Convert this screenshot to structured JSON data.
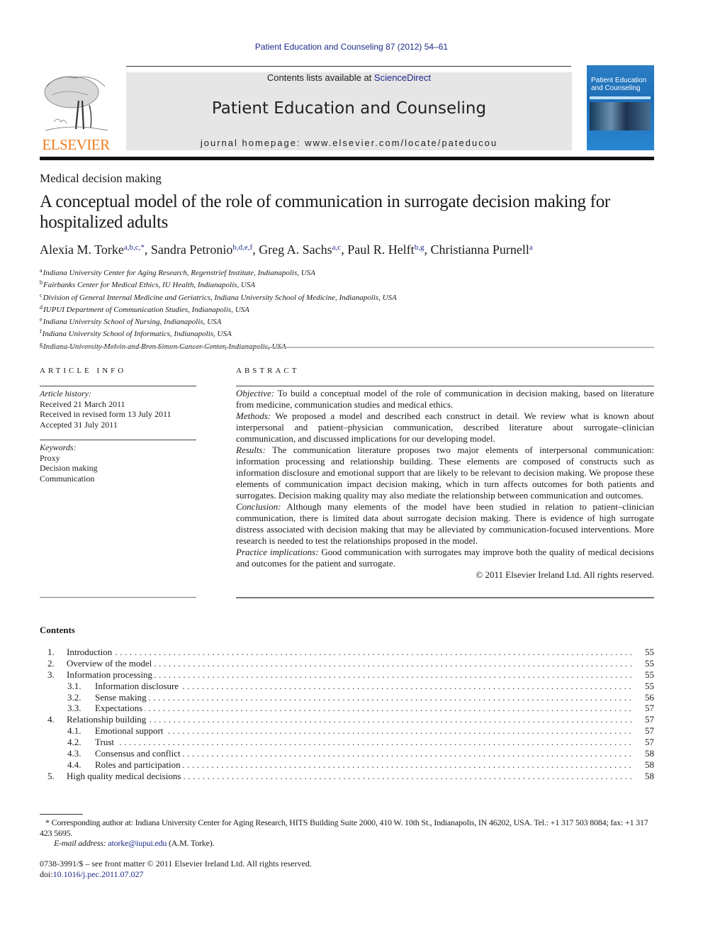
{
  "citation": "Patient Education and Counseling 87 (2012) 54–61",
  "header": {
    "publisher_logo_text": "ELSEVIER",
    "contents_available_prefix": "Contents lists available at ",
    "contents_available_link": "ScienceDirect",
    "journal_title": "Patient Education and Counseling",
    "homepage": "journal homepage: www.elsevier.com/locate/pateducou",
    "cover_title": "Patient Education and Counseling"
  },
  "article": {
    "section": "Medical decision making",
    "title": "A conceptual model of the role of communication in surrogate decision making for hospitalized adults",
    "authors": [
      {
        "name": "Alexia M. Torke",
        "affil": "a,b,c,*"
      },
      {
        "name": "Sandra Petronio",
        "affil": "b,d,e,f"
      },
      {
        "name": "Greg A. Sachs",
        "affil": "a,c"
      },
      {
        "name": "Paul R. Helft",
        "affil": "b,g"
      },
      {
        "name": "Christianna Purnell",
        "affil": "a"
      }
    ],
    "affiliations": [
      {
        "key": "a",
        "text": "Indiana University Center for Aging Research, Regenstrief Institute, Indianapolis, USA"
      },
      {
        "key": "b",
        "text": "Fairbanks Center for Medical Ethics, IU Health, Indianapolis, USA"
      },
      {
        "key": "c",
        "text": "Division of General Internal Medicine and Geriatrics, Indiana University School of Medicine, Indianapolis, USA"
      },
      {
        "key": "d",
        "text": "IUPUI Department of Communication Studies, Indianapolis, USA"
      },
      {
        "key": "e",
        "text": "Indiana University School of Nursing, Indianapolis, USA"
      },
      {
        "key": "f",
        "text": "Indiana University School of Informatics, Indianapolis, USA"
      },
      {
        "key": "g",
        "text": "Indiana University Melvin and Bren Simon Cancer Center, Indianapolis, USA"
      }
    ]
  },
  "article_info": {
    "heading": "ARTICLE INFO",
    "history_label": "Article history:",
    "history": [
      "Received 21 March 2011",
      "Received in revised form 13 July 2011",
      "Accepted 31 July 2011"
    ],
    "keywords_label": "Keywords:",
    "keywords": [
      "Proxy",
      "Decision making",
      "Communication"
    ]
  },
  "abstract": {
    "heading": "ABSTRACT",
    "sections": [
      {
        "label": "Objective:",
        "text": " To build a conceptual model of the role of communication in decision making, based on literature from medicine, communication studies and medical ethics."
      },
      {
        "label": "Methods:",
        "text": "  We proposed a model and described each construct in detail. We review what is known about interpersonal and patient–physician communication, described literature about surrogate–clinician communication, and discussed implications for our developing model."
      },
      {
        "label": "Results:",
        "text": " The communication literature proposes two major elements of interpersonal communication: information processing and relationship building. These elements are composed of constructs such as information disclosure and emotional support that are likely to be relevant to decision making. We propose these elements of communication impact decision making, which in turn affects outcomes for both patients and surrogates. Decision making quality may also mediate the relationship between communication and outcomes."
      },
      {
        "label": "Conclusion:",
        "text": " Although many elements of the model have been studied in relation to patient–clinician communication, there is limited data about surrogate decision making. There is evidence of high surrogate distress associated with decision making that may be alleviated by communication-focused interventions. More research is needed to test the relationships proposed in the model."
      },
      {
        "label": "Practice implications:",
        "text": " Good communication with surrogates may improve both the quality of medical decisions and outcomes for the patient and surrogate."
      }
    ],
    "copyright": "© 2011 Elsevier Ireland Ltd. All rights reserved."
  },
  "contents": {
    "heading": "Contents",
    "items": [
      {
        "num": "1.",
        "title": "Introduction",
        "page": "55",
        "level": 1
      },
      {
        "num": "2.",
        "title": "Overview of the model",
        "page": "55",
        "level": 1
      },
      {
        "num": "3.",
        "title": "Information processing",
        "page": "55",
        "level": 1
      },
      {
        "num": "3.1.",
        "title": "Information disclosure",
        "page": "55",
        "level": 2
      },
      {
        "num": "3.2.",
        "title": "Sense making",
        "page": "56",
        "level": 2
      },
      {
        "num": "3.3.",
        "title": "Expectations",
        "page": "57",
        "level": 2
      },
      {
        "num": "4.",
        "title": "Relationship building",
        "page": "57",
        "level": 1
      },
      {
        "num": "4.1.",
        "title": "Emotional support",
        "page": "57",
        "level": 2
      },
      {
        "num": "4.2.",
        "title": "Trust",
        "page": "57",
        "level": 2
      },
      {
        "num": "4.3.",
        "title": "Consensus and conflict",
        "page": "58",
        "level": 2
      },
      {
        "num": "4.4.",
        "title": "Roles and participation",
        "page": "58",
        "level": 2
      },
      {
        "num": "5.",
        "title": "High quality medical decisions",
        "page": "58",
        "level": 1
      }
    ]
  },
  "footnotes": {
    "corresponding": "* Corresponding author at: Indiana University Center for Aging Research, HITS Building Suite 2000, 410 W. 10th St., Indianapolis, IN 46202, USA. Tel.: +1 317 503 8084; fax: +1 317 423 5695.",
    "email_label": "E-mail address:",
    "email": "atorke@iupui.edu",
    "email_suffix": " (A.M. Torke).",
    "front_matter": "0738-3991/$ – see front matter © 2011 Elsevier Ireland Ltd. All rights reserved.",
    "doi_prefix": "doi:",
    "doi": "10.1016/j.pec.2011.07.027"
  },
  "colors": {
    "link": "#1f2a8a",
    "elsevier_orange": "#f07d20",
    "header_band": "#e6e6e6",
    "cover_blue": "#2b7ec6"
  }
}
